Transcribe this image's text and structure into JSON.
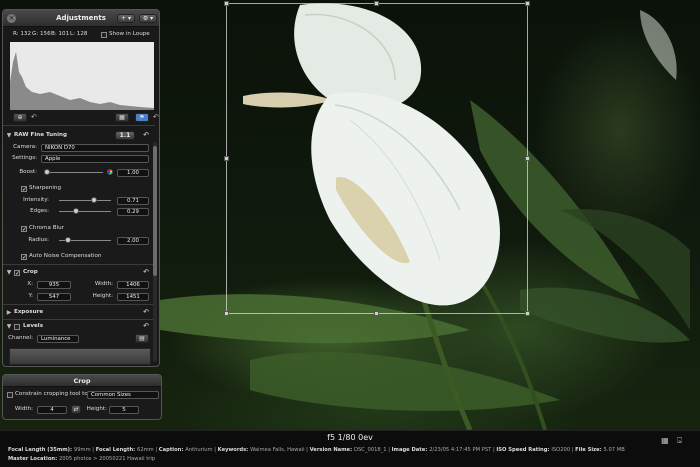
{
  "hud": {
    "title": "Adjustments",
    "add_label": "+ ▾",
    "gear_label": "⚙ ▾",
    "readout": {
      "r": "R: 132",
      "g": "G: 156",
      "b": "B: 101",
      "l": "L: 128"
    },
    "show_in_loupe": "Show in Loupe",
    "raw": {
      "title": "RAW Fine Tuning",
      "version": "1.1",
      "camera_label": "Camera:",
      "camera_value": "NIKON D70",
      "settings_label": "Settings:",
      "settings_value": "Apple",
      "boost_label": "Boost:",
      "boost_value": "1.00",
      "sharpening_label": "Sharpening",
      "intensity_label": "Intensity:",
      "intensity_value": "0.71",
      "edges_label": "Edges:",
      "edges_value": "0.29",
      "chroma_label": "Chroma Blur",
      "radius_label": "Radius:",
      "radius_value": "2.00",
      "auto_noise_label": "Auto Noise Compensation"
    },
    "crop": {
      "title": "Crop",
      "x_label": "X:",
      "x_value": "935",
      "y_label": "Y:",
      "y_value": "547",
      "width_label": "Width:",
      "width_value": "1406",
      "height_label": "Height:",
      "height_value": "1451"
    },
    "exposure": {
      "title": "Exposure"
    },
    "levels": {
      "title": "Levels",
      "channel_label": "Channel:",
      "channel_value": "Luminance"
    }
  },
  "crop_hud": {
    "title": "Crop",
    "constrain_label": "Constrain cropping tool to:",
    "constrain_value": "Common Sizes",
    "width_label": "Width:",
    "width_value": "4",
    "height_label": "Height:",
    "height_value": "5",
    "swap_icon": "swap-icon"
  },
  "meta": {
    "headline": "f5 1/80 0ev",
    "line1": [
      {
        "k": "Focal Length (35mm):",
        "v": "99mm"
      },
      {
        "k": "Focal Length:",
        "v": "62mm"
      },
      {
        "k": "Caption:",
        "v": "Anthurium"
      },
      {
        "k": "Keywords:",
        "v": "Waimea Falls, Hawaii"
      },
      {
        "k": "Version Name:",
        "v": "DSC_0018_1"
      },
      {
        "k": "Image Date:",
        "v": "2/23/05 4:17:45 PM PST"
      },
      {
        "k": "ISO Speed Rating:",
        "v": "ISO200"
      },
      {
        "k": "File Size:",
        "v": "5.07 MB"
      }
    ],
    "line2": [
      {
        "k": "Master Location:",
        "v": "2005 photos > 20050221 Hawaii trip"
      }
    ]
  },
  "colors": {
    "accent": "#4a80c8",
    "hud_bg": "#1a1a1a"
  }
}
